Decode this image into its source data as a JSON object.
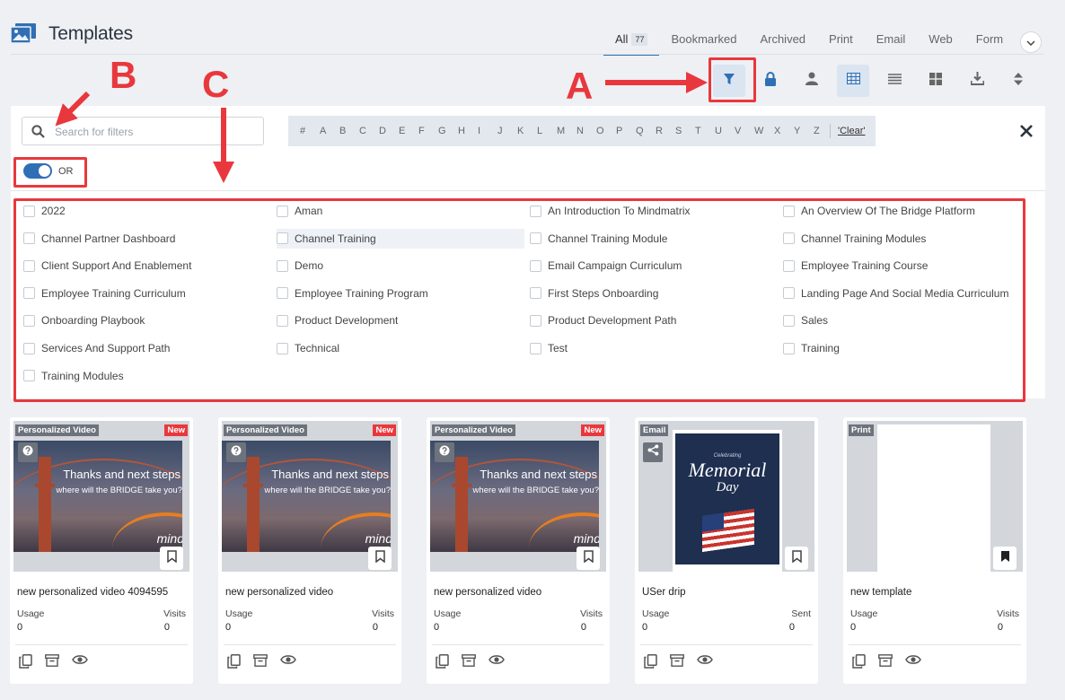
{
  "header": {
    "title": "Templates",
    "tabs": [
      {
        "label": "All",
        "count": "77"
      },
      {
        "label": "Bookmarked"
      },
      {
        "label": "Archived"
      },
      {
        "label": "Print"
      },
      {
        "label": "Email"
      },
      {
        "label": "Web"
      },
      {
        "label": "Form"
      }
    ]
  },
  "toolbar": {
    "buttons": [
      "filter-icon",
      "lock-icon",
      "user-icon",
      "grid-icon",
      "list-icon",
      "tiles-icon",
      "download-icon",
      "sort-icon"
    ]
  },
  "filters": {
    "search_placeholder": "Search for filters",
    "alphabet": [
      "#",
      "A",
      "B",
      "C",
      "D",
      "E",
      "F",
      "G",
      "H",
      "I",
      "J",
      "K",
      "L",
      "M",
      "N",
      "O",
      "P",
      "Q",
      "R",
      "S",
      "T",
      "U",
      "V",
      "W",
      "X",
      "Y",
      "Z"
    ],
    "clear_label": "'Clear'",
    "toggle_label": "OR",
    "items": [
      "2022",
      "Aman",
      "An Introduction To Mindmatrix",
      "An Overview Of The Bridge Platform",
      "Channel Partner Dashboard",
      "Channel Training",
      "Channel Training Module",
      "Channel Training Modules",
      "Client Support And Enablement",
      "Demo",
      "Email Campaign Curriculum",
      "Employee Training Course",
      "Employee Training Curriculum",
      "Employee Training Program",
      "First Steps Onboarding",
      "Landing Page And Social Media Curriculum",
      "Onboarding Playbook",
      "Product Development",
      "Product Development Path",
      "Sales",
      "Services And Support Path",
      "Technical",
      "Test",
      "Training",
      "Training Modules"
    ]
  },
  "annotations": {
    "a": "A",
    "b": "B",
    "c": "C"
  },
  "cards": [
    {
      "type": "Personalized Video",
      "new": "New",
      "name": "new personalized video 4094595",
      "stat1_label": "Usage",
      "stat1": "0",
      "stat2_label": "Visits",
      "stat2": "0",
      "video_title": "Thanks and next steps",
      "video_sub": "where will the BRIDGE take you?",
      "brand": "mind"
    },
    {
      "type": "Personalized Video",
      "new": "New",
      "name": "new personalized video",
      "stat1_label": "Usage",
      "stat1": "0",
      "stat2_label": "Visits",
      "stat2": "0",
      "video_title": "Thanks and next steps",
      "video_sub": "where will the BRIDGE take you?",
      "brand": "mind"
    },
    {
      "type": "Personalized Video",
      "new": "New",
      "name": "new personalized video",
      "stat1_label": "Usage",
      "stat1": "0",
      "stat2_label": "Visits",
      "stat2": "0",
      "video_title": "Thanks and next steps",
      "video_sub": "where will the BRIDGE take you?",
      "brand": "mind"
    },
    {
      "type": "Email",
      "name": "USer drip",
      "stat1_label": "Usage",
      "stat1": "0",
      "stat2_label": "Sent",
      "stat2": "0",
      "art_celebrating": "Celebrating",
      "art_memorial": "Memorial",
      "art_day": "Day"
    },
    {
      "type": "Print",
      "name": "new template",
      "stat1_label": "Usage",
      "stat1": "0",
      "stat2_label": "Visits",
      "stat2": "0"
    }
  ],
  "colors": {
    "accent": "#2f6fb5",
    "annotation": "#e8383d",
    "badge": "#6d737c"
  }
}
